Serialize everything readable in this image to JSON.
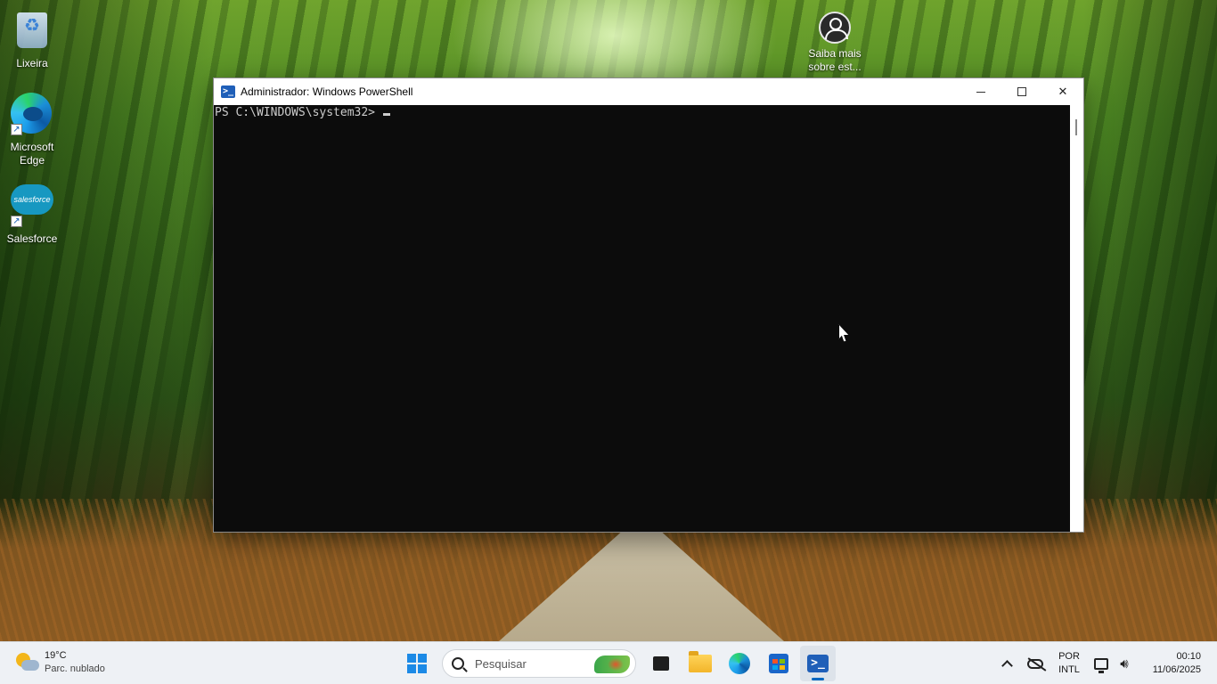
{
  "desktop": {
    "icons": [
      {
        "label": "Lixeira",
        "icon": "recycle-bin-icon"
      },
      {
        "label": "Microsoft Edge",
        "icon": "edge-icon",
        "shortcut": true
      },
      {
        "label": "Salesforce",
        "icon": "salesforce-icon",
        "shortcut": true,
        "logo_text": "salesforce"
      },
      {
        "label": "Saiba mais sobre est...",
        "icon": "learn-more-icon"
      }
    ]
  },
  "window": {
    "title": "Administrador: Windows PowerShell",
    "app_icon": "powershell-icon",
    "controls": [
      "minimize-icon",
      "maximize-icon",
      "close-icon"
    ],
    "console": {
      "prompt": "PS C:\\WINDOWS\\system32> ",
      "background": "#0c0c0c",
      "foreground": "#cccccc"
    }
  },
  "taskbar": {
    "weather": {
      "temp": "19°C",
      "condition": "Parc. nublado"
    },
    "search": {
      "placeholder": "Pesquisar"
    },
    "apps": [
      {
        "name": "start",
        "icon": "windows-icon"
      },
      {
        "name": "task-view",
        "icon": "task-view-icon"
      },
      {
        "name": "file-explorer",
        "icon": "folder-icon"
      },
      {
        "name": "edge",
        "icon": "edge-icon"
      },
      {
        "name": "store",
        "icon": "store-icon"
      },
      {
        "name": "powershell",
        "icon": "powershell-icon",
        "active": true
      }
    ],
    "tray": {
      "lang_top": "POR",
      "lang_bottom": "INTL",
      "time": "00:10",
      "date": "11/06/2025"
    },
    "accent": "#0067c0"
  }
}
